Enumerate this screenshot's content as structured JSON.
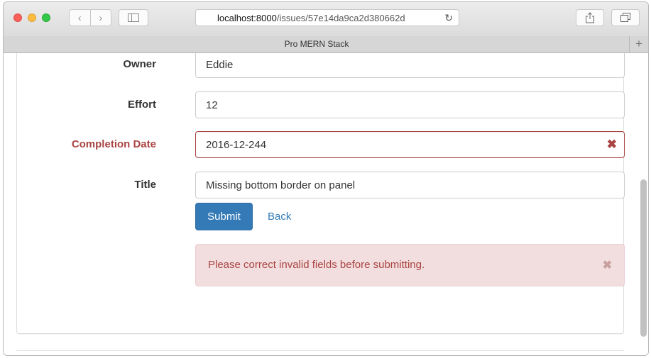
{
  "browser": {
    "url_host": "localhost:8000",
    "url_path": "/issues/57e14da9ca2d380662d",
    "tab_title": "Pro MERN Stack"
  },
  "form": {
    "owner": {
      "label": "Owner",
      "value": "Eddie"
    },
    "effort": {
      "label": "Effort",
      "value": "12"
    },
    "completion_date": {
      "label": "Completion Date",
      "value": "2016-12-244",
      "error_icon": "✖"
    },
    "title": {
      "label": "Title",
      "value": "Missing bottom border on panel"
    }
  },
  "actions": {
    "submit_label": "Submit",
    "back_label": "Back"
  },
  "alert": {
    "message": "Please correct invalid fields before submitting.",
    "close_icon": "✖"
  },
  "colors": {
    "error": "#a94442",
    "primary": "#337ab7",
    "alert_bg": "#f2dede"
  }
}
